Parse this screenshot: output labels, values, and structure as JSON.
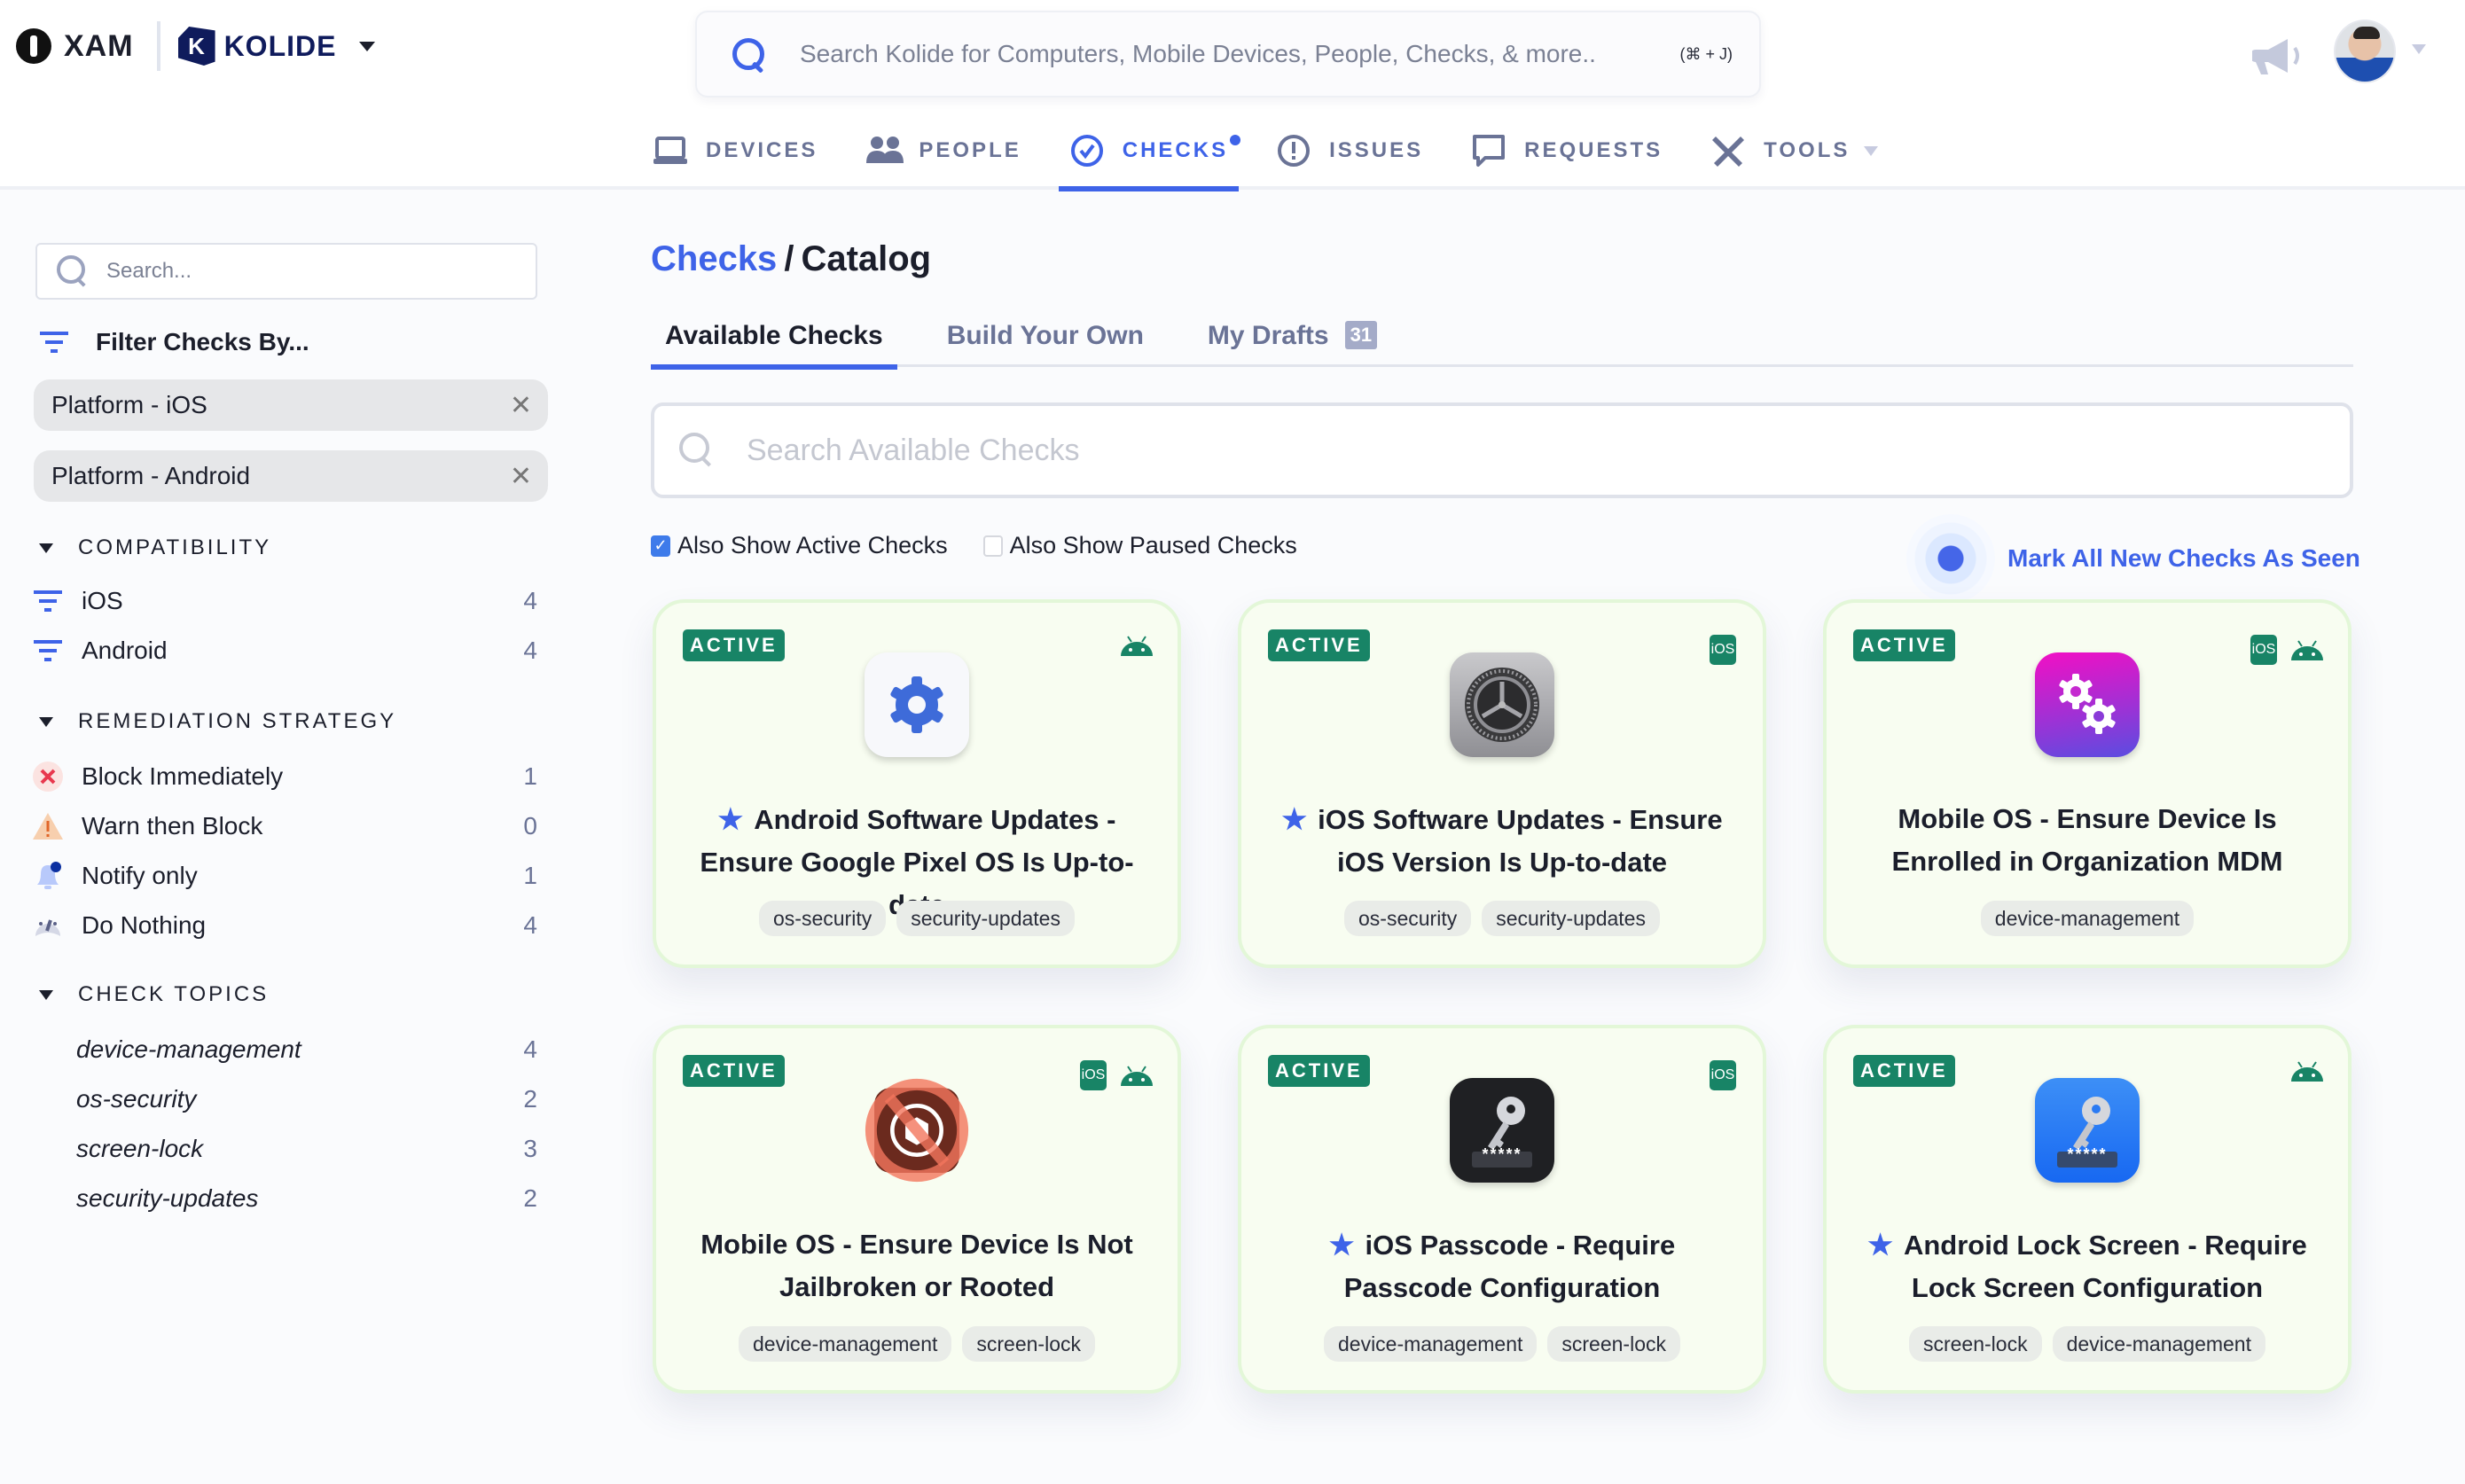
{
  "header": {
    "org_name": "XAM",
    "brand_name": "KOLIDE",
    "global_search_placeholder": "Search Kolide for Computers, Mobile Devices, People, Checks, & more..",
    "global_search_shortcut": "(⌘ + J)",
    "nav": [
      {
        "label": "DEVICES",
        "icon": "laptop-icon",
        "active": false
      },
      {
        "label": "PEOPLE",
        "icon": "people-icon",
        "active": false
      },
      {
        "label": "CHECKS",
        "icon": "check-circle-icon",
        "active": true,
        "has_dot": true
      },
      {
        "label": "ISSUES",
        "icon": "exclamation-circle-icon",
        "active": false
      },
      {
        "label": "REQUESTS",
        "icon": "speech-bubble-icon",
        "active": false
      },
      {
        "label": "TOOLS",
        "icon": "tools-icon",
        "active": false,
        "has_dropdown": true
      }
    ]
  },
  "sidebar": {
    "search_placeholder": "Search...",
    "filter_heading": "Filter Checks By...",
    "active_filters": [
      "Platform - iOS",
      "Platform - Android"
    ],
    "sections": [
      {
        "title": "COMPATIBILITY",
        "items": [
          {
            "label": "iOS",
            "count": "4",
            "icon": "filter-icon"
          },
          {
            "label": "Android",
            "count": "4",
            "icon": "filter-icon"
          }
        ]
      },
      {
        "title": "REMEDIATION STRATEGY",
        "items": [
          {
            "label": "Block Immediately",
            "count": "1",
            "icon": "block-x-icon"
          },
          {
            "label": "Warn then Block",
            "count": "0",
            "icon": "warning-triangle-icon"
          },
          {
            "label": "Notify only",
            "count": "1",
            "icon": "bell-notify-icon"
          },
          {
            "label": "Do Nothing",
            "count": "4",
            "icon": "gauge-icon"
          }
        ]
      },
      {
        "title": "CHECK TOPICS",
        "items": [
          {
            "label": "device-management",
            "count": "4"
          },
          {
            "label": "os-security",
            "count": "2"
          },
          {
            "label": "screen-lock",
            "count": "3"
          },
          {
            "label": "security-updates",
            "count": "2"
          }
        ]
      }
    ]
  },
  "main": {
    "breadcrumb": {
      "parent": "Checks",
      "separator": "/",
      "current": "Catalog"
    },
    "tabs": [
      {
        "label": "Available Checks",
        "active": true
      },
      {
        "label": "Build Your Own",
        "active": false
      },
      {
        "label": "My Drafts",
        "active": false,
        "badge": "31"
      }
    ],
    "search_placeholder": "Search Available Checks",
    "options": [
      {
        "label": "Also Show Active Checks",
        "checked": true
      },
      {
        "label": "Also Show Paused Checks",
        "checked": false
      }
    ],
    "mark_seen_label": "Mark All New Checks As Seen",
    "status_color": "#188466",
    "accent_color": "#3e63e8",
    "cards": [
      {
        "status": "ACTIVE",
        "platforms": [
          "android"
        ],
        "icon": "android-settings-gear-icon",
        "starred": true,
        "title": "Android Software Updates - Ensure Google Pixel OS Is Up-to-date",
        "tags": [
          "os-security",
          "security-updates"
        ]
      },
      {
        "status": "ACTIVE",
        "platforms": [
          "ios"
        ],
        "icon": "ios-settings-gear-icon",
        "starred": true,
        "title": "iOS Software Updates - Ensure iOS Version Is Up-to-date",
        "tags": [
          "os-security",
          "security-updates"
        ]
      },
      {
        "status": "ACTIVE",
        "platforms": [
          "ios",
          "android"
        ],
        "icon": "mdm-gears-icon",
        "starred": false,
        "title": "Mobile OS - Ensure Device Is Enrolled in Organization MDM",
        "tags": [
          "device-management"
        ]
      },
      {
        "status": "ACTIVE",
        "platforms": [
          "ios",
          "android"
        ],
        "icon": "jailbreak-prohibited-icon",
        "starred": false,
        "title": "Mobile OS - Ensure Device Is Not Jailbroken or Rooted",
        "tags": [
          "device-management",
          "screen-lock"
        ]
      },
      {
        "status": "ACTIVE",
        "platforms": [
          "ios"
        ],
        "icon": "dark-passcode-key-icon",
        "starred": true,
        "title": "iOS Passcode - Require Passcode Configuration",
        "tags": [
          "device-management",
          "screen-lock"
        ]
      },
      {
        "status": "ACTIVE",
        "platforms": [
          "android"
        ],
        "icon": "blue-passcode-key-icon",
        "starred": true,
        "title": "Android Lock Screen - Require Lock Screen Configuration",
        "tags": [
          "screen-lock",
          "device-management"
        ]
      }
    ],
    "ios_badge_label": "iOS",
    "passcode_mask": "*****"
  }
}
